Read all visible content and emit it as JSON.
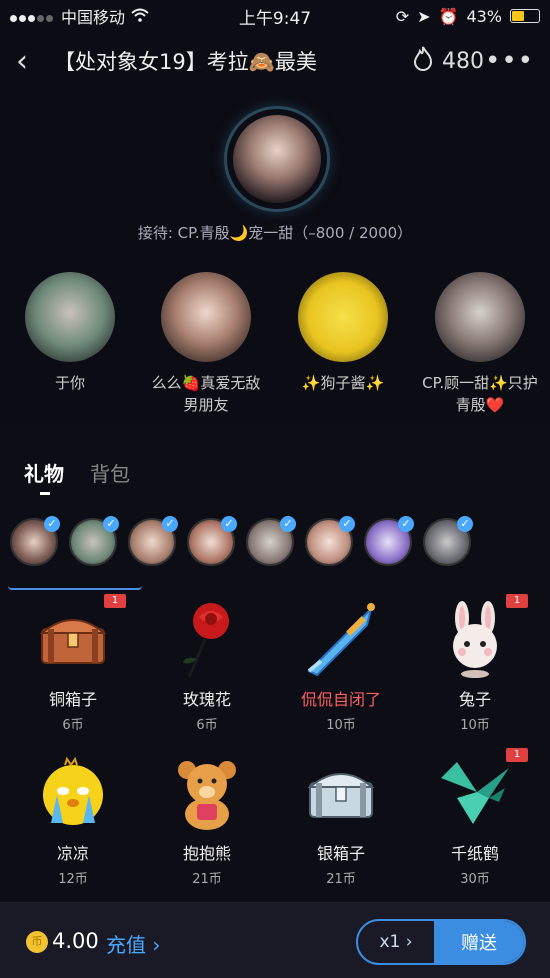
{
  "status": {
    "carrier": "中国移动",
    "time": "上午9:47",
    "battery_pct": "43%",
    "battery_level": 0.43
  },
  "room": {
    "title": "【处对象女19】考拉🙈最美",
    "heat": "480",
    "host_label": "接待: CP.青殷🌙宠一甜（–800 / 2000）"
  },
  "seats": [
    {
      "name": "于你"
    },
    {
      "name": "么么🍓真爱无敌\n男朋友"
    },
    {
      "name": "✨狗子酱✨"
    },
    {
      "name": "CP.顾一甜✨只护\n青殷❤️"
    }
  ],
  "panel": {
    "tabs": [
      {
        "label": "礼物",
        "active": true
      },
      {
        "label": "背包",
        "active": false
      }
    ],
    "recipient_count": 8,
    "gifts": [
      {
        "name": "铜箱子",
        "price": "6币",
        "badge": "1",
        "icon": "treasure-chest-icon"
      },
      {
        "name": "玫瑰花",
        "price": "6币",
        "badge": "",
        "icon": "rose-icon"
      },
      {
        "name": "侃侃自闭了",
        "price": "10币",
        "badge": "",
        "icon": "sword-icon",
        "highlight": true
      },
      {
        "name": "兔子",
        "price": "10币",
        "badge": "1",
        "icon": "rabbit-icon"
      },
      {
        "name": "凉凉",
        "price": "12币",
        "badge": "",
        "icon": "crying-chick-icon"
      },
      {
        "name": "抱抱熊",
        "price": "21币",
        "badge": "",
        "icon": "teddy-bear-icon"
      },
      {
        "name": "银箱子",
        "price": "21币",
        "badge": "",
        "icon": "silver-chest-icon"
      },
      {
        "name": "千纸鹤",
        "price": "30币",
        "badge": "1",
        "icon": "paper-crane-icon"
      }
    ]
  },
  "bottom": {
    "coin_symbol": "币",
    "balance": "4.00",
    "recharge_label": "充值 ›",
    "qty_label": "x1 ›",
    "send_label": "赠送"
  }
}
